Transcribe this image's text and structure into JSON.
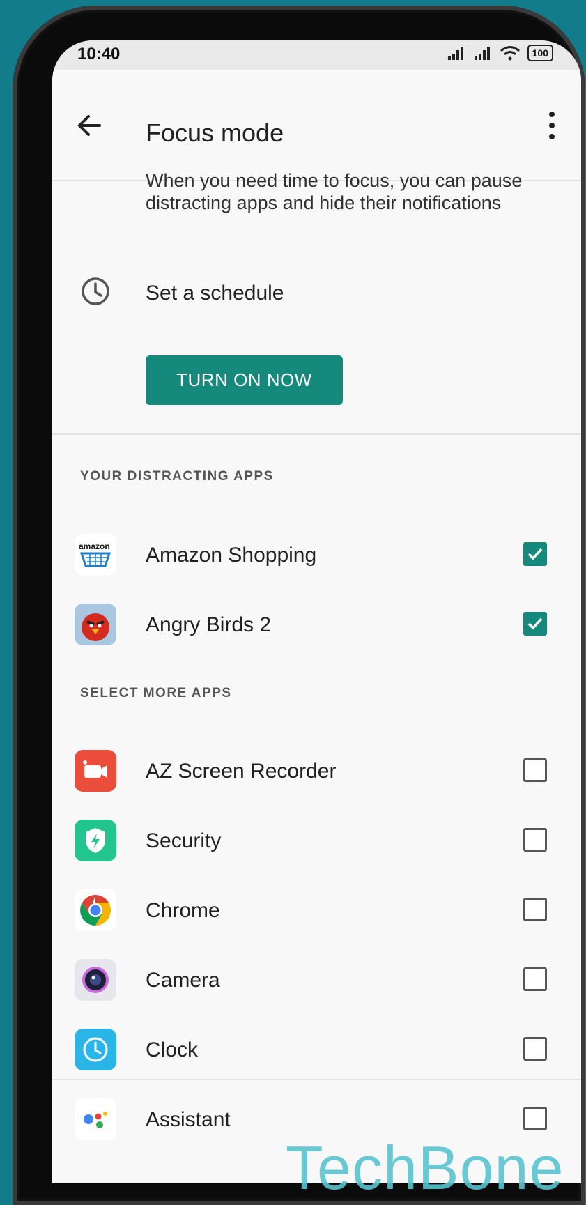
{
  "status_bar": {
    "time": "10:40",
    "battery": "100"
  },
  "header": {
    "title": "Focus mode"
  },
  "description": "When you need time to focus, you can pause distracting apps and hide their notifications",
  "schedule": {
    "label": "Set a schedule"
  },
  "turn_on_button": "TURN ON NOW",
  "sections": {
    "distracting": "YOUR DISTRACTING APPS",
    "more": "SELECT MORE APPS"
  },
  "distracting_apps": [
    {
      "name": "Amazon Shopping",
      "checked": true,
      "icon": "amazon-icon"
    },
    {
      "name": "Angry Birds 2",
      "checked": true,
      "icon": "angry-birds-icon"
    }
  ],
  "more_apps": [
    {
      "name": "AZ Screen Recorder",
      "checked": false,
      "icon": "screen-recorder-icon"
    },
    {
      "name": "Security",
      "checked": false,
      "icon": "security-shield-icon"
    },
    {
      "name": "Chrome",
      "checked": false,
      "icon": "chrome-icon"
    },
    {
      "name": "Camera",
      "checked": false,
      "icon": "camera-icon"
    },
    {
      "name": "Clock",
      "checked": false,
      "icon": "clock-app-icon"
    },
    {
      "name": "Assistant",
      "checked": false,
      "icon": "assistant-icon"
    }
  ],
  "watermark": "TechBone",
  "colors": {
    "accent": "#158a7c",
    "background": "#137c8b"
  }
}
